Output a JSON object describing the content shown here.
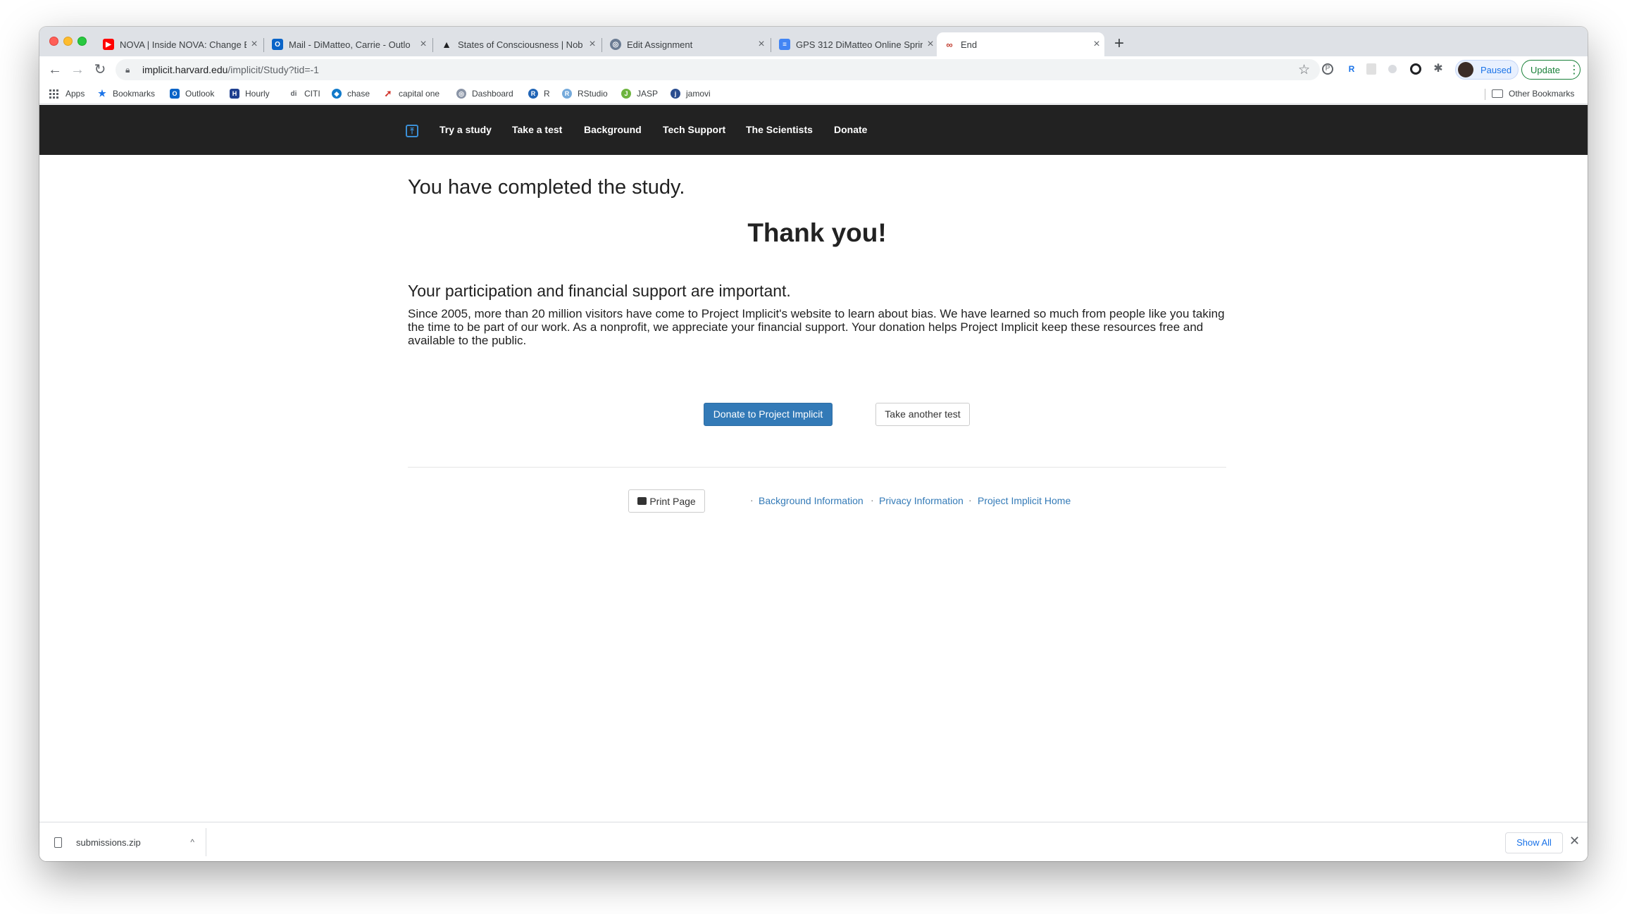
{
  "tabs": [
    {
      "title": "NOVA | Inside NOVA: Change E",
      "icon": "youtube-icon"
    },
    {
      "title": "Mail - DiMatteo, Carrie - Outlo",
      "icon": "outlook-icon"
    },
    {
      "title": "States of Consciousness | Nob",
      "icon": "nob-icon"
    },
    {
      "title": "Edit Assignment",
      "icon": "canvas-icon"
    },
    {
      "title": "GPS 312 DiMatteo Online Sprin",
      "icon": "docs-icon"
    },
    {
      "title": "End",
      "icon": "implicit-icon"
    }
  ],
  "toolbar": {
    "url_host": "implicit.harvard.edu",
    "url_path": "/implicit/Study?tid=-1",
    "paused_label": "Paused",
    "update_label": "Update"
  },
  "bookmarks": [
    {
      "label": "Apps"
    },
    {
      "label": "Bookmarks"
    },
    {
      "label": "Outlook"
    },
    {
      "label": "Hourly"
    },
    {
      "label": "CITI"
    },
    {
      "label": "chase"
    },
    {
      "label": "capital one"
    },
    {
      "label": "Dashboard"
    },
    {
      "label": "R"
    },
    {
      "label": "RStudio"
    },
    {
      "label": "JASP"
    },
    {
      "label": "jamovi"
    }
  ],
  "other_bookmarks": "Other Bookmarks",
  "site_nav": [
    "Try a study",
    "Take a test",
    "Background",
    "Tech Support",
    "The Scientists",
    "Donate"
  ],
  "content": {
    "completed": "You have completed the study.",
    "thanks": "Thank you!",
    "subhead": "Your participation and financial support are important.",
    "paragraph": "Since 2005, more than 20 million visitors have come to Project Implicit's website to learn about bias. We have learned so much from people like you taking the time to be part of our work. As a nonprofit, we appreciate your financial support. Your donation helps Project Implicit keep these resources free and available to the public.",
    "donate_button": "Donate to Project Implicit",
    "another_button": "Take another test",
    "print_button": "Print Page",
    "footer_separator": "·",
    "footer_links": [
      "Background Information",
      "Privacy Information",
      "Project Implicit Home"
    ]
  },
  "download": {
    "filename": "submissions.zip",
    "show_all": "Show All"
  },
  "colors": {
    "navbar": "#222222",
    "primary_button": "#337ab7",
    "link": "#337ab7"
  }
}
